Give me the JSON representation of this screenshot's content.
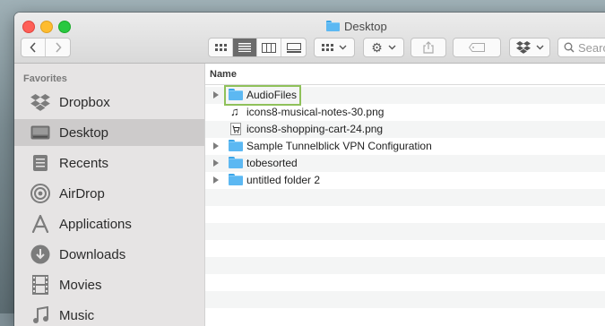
{
  "window": {
    "title": "Desktop"
  },
  "toolbar": {
    "search_placeholder": "Search",
    "view_modes": [
      "icon-view",
      "list-view",
      "column-view",
      "gallery-view"
    ],
    "active_view": "list-view"
  },
  "sidebar": {
    "header": "Favorites",
    "items": [
      {
        "label": "Dropbox",
        "icon": "dropbox-icon"
      },
      {
        "label": "Desktop",
        "icon": "desktop-icon",
        "selected": true
      },
      {
        "label": "Recents",
        "icon": "recents-icon"
      },
      {
        "label": "AirDrop",
        "icon": "airdrop-icon"
      },
      {
        "label": "Applications",
        "icon": "applications-icon"
      },
      {
        "label": "Downloads",
        "icon": "downloads-icon"
      },
      {
        "label": "Movies",
        "icon": "movies-icon"
      },
      {
        "label": "Music",
        "icon": "music-icon"
      }
    ]
  },
  "list": {
    "column_name": "Name",
    "rows": [
      {
        "label": "AudioFiles",
        "type": "folder",
        "expandable": true,
        "highlighted": true
      },
      {
        "label": "icons8-musical-notes-30.png",
        "type": "image",
        "expandable": false
      },
      {
        "label": "icons8-shopping-cart-24.png",
        "type": "image",
        "expandable": false
      },
      {
        "label": "Sample Tunnelblick VPN Configuration",
        "type": "folder",
        "expandable": true
      },
      {
        "label": "tobesorted",
        "type": "folder",
        "expandable": true
      },
      {
        "label": "untitled folder 2",
        "type": "folder",
        "expandable": true
      }
    ]
  },
  "colors": {
    "highlight_border": "#8fc15a",
    "folder_blue": "#5cb8f2",
    "sidebar_selected": "#cdcbcb"
  }
}
